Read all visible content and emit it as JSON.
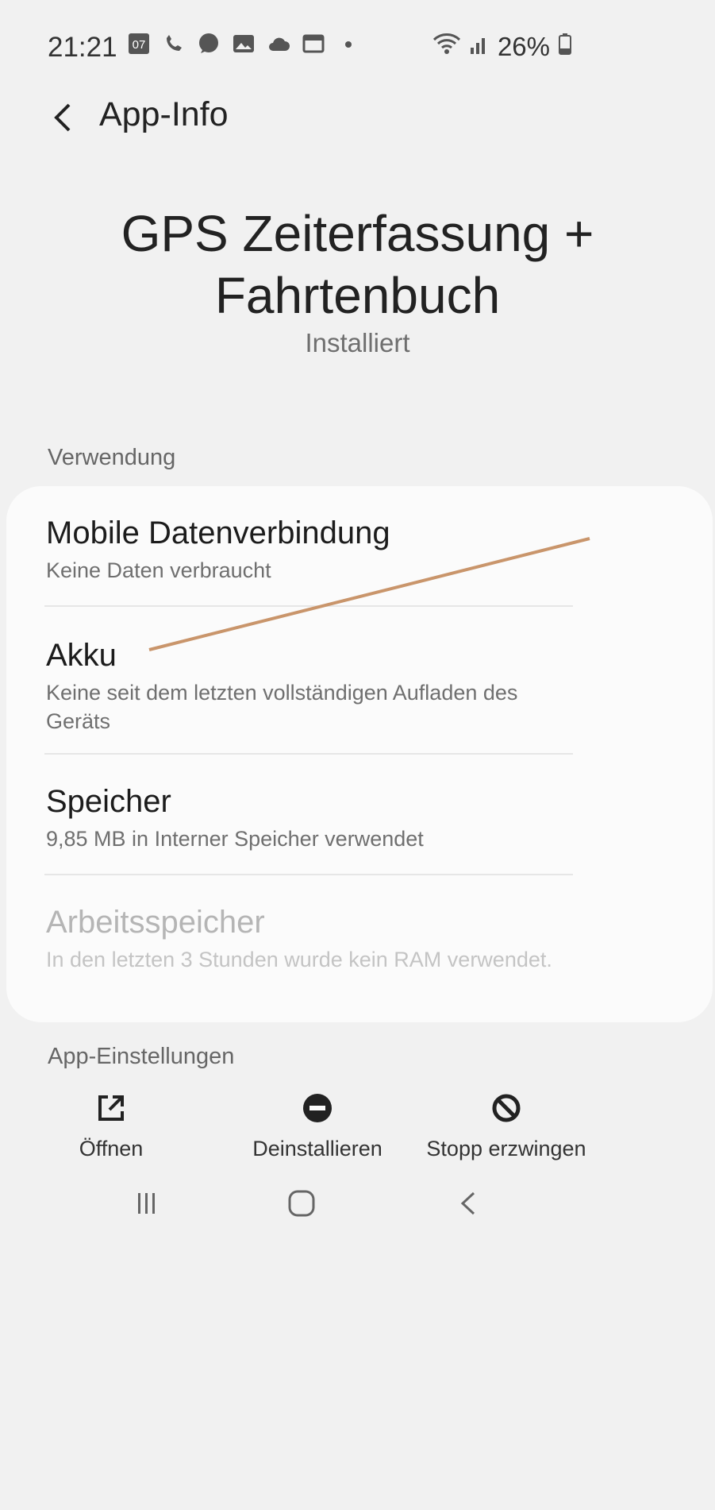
{
  "status_bar": {
    "time": "21:21",
    "notification_badge": "07",
    "battery": "26%"
  },
  "toolbar": {
    "title": "App-Info"
  },
  "app": {
    "name": "GPS Zeiterfassung + Fahrtenbuch",
    "status": "Installiert"
  },
  "sections": {
    "usage": "Verwendung",
    "settings": "App-Einstellungen"
  },
  "usage_items": [
    {
      "title": "Mobile Datenverbindung",
      "subtitle": "Keine Daten verbraucht"
    },
    {
      "title": "Akku",
      "subtitle": "Keine seit dem letzten vollständigen Aufladen des Geräts"
    },
    {
      "title": "Speicher",
      "subtitle": "9,85 MB in Interner Speicher verwendet"
    },
    {
      "title": "Arbeitsspeicher",
      "subtitle": "In den letzten 3 Stunden wurde kein RAM verwendet."
    }
  ],
  "actions": {
    "open": "Öffnen",
    "uninstall": "Deinstallieren",
    "force_stop": "Stopp erzwingen"
  },
  "colors": {
    "background": "#f1f1f1",
    "card": "#fbfbfb",
    "annotation_line": "#c9956b"
  }
}
